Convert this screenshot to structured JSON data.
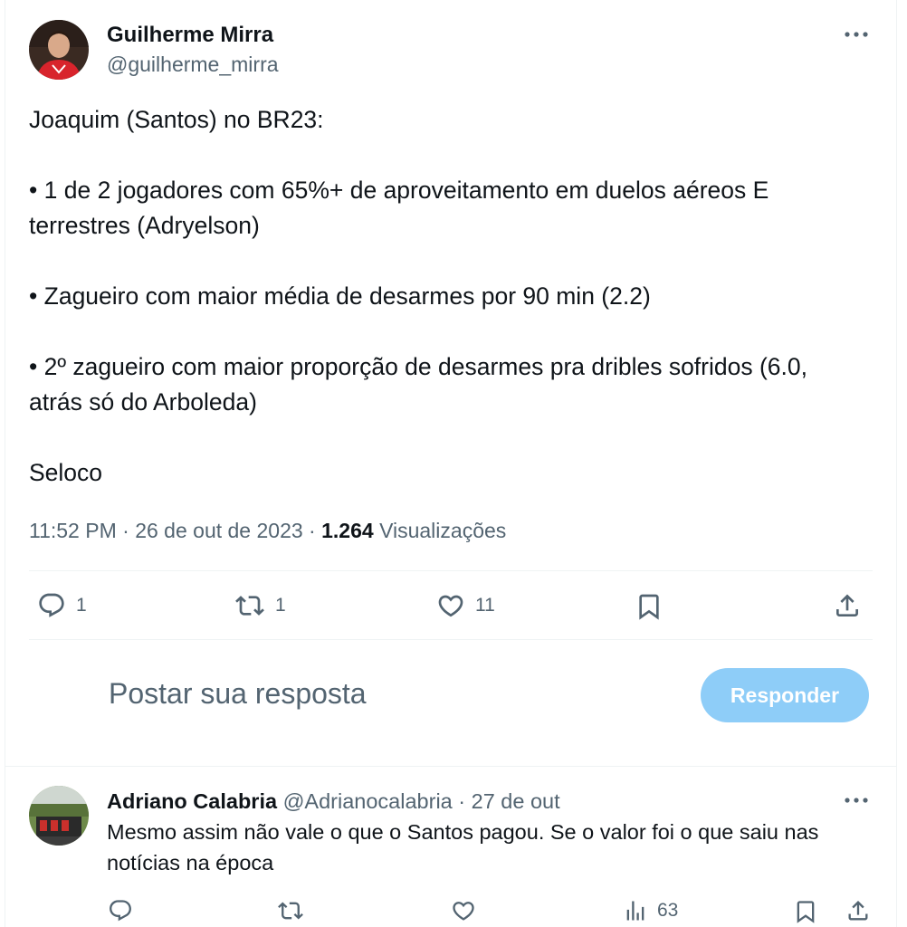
{
  "tweet": {
    "author_name": "Guilherme Mirra",
    "author_handle": "@guilherme_mirra",
    "more_icon": "more-horizontal-icon",
    "lines": [
      "Joaquim (Santos) no BR23:",
      "• 1 de 2 jogadores com 65%+ de aproveitamento em duelos aéreos E",
      "terrestres (Adryelson)",
      "• Zagueiro com maior média de desarmes por 90 min (2.2)",
      "• 2º zagueiro com maior proporção de desarmes pra dribles sofridos (6.0,",
      "atrás só do Arboleda)",
      "Seloco"
    ],
    "time": "11:52 PM",
    "date": "26 de out de 2023",
    "views_count": "1.264",
    "views_label": "Visualizações",
    "separator": "·"
  },
  "actions": {
    "replies": "1",
    "retweets": "1",
    "likes": "11"
  },
  "compose": {
    "placeholder": "Postar sua resposta",
    "button_label": "Responder"
  },
  "reply": {
    "author_name": "Adriano Calabria",
    "author_handle": "@Adrianocalabria",
    "date": "27 de out",
    "separator": "·",
    "lines": [
      "Mesmo assim não vale o que o Santos pagou. Se o valor foi o que saiu nas",
      "notícias na época"
    ],
    "views": "63"
  },
  "colors": {
    "text": "#0f1419",
    "secondary": "#536471",
    "button_disabled": "#8ecdf8",
    "divider": "#eff3f4"
  }
}
